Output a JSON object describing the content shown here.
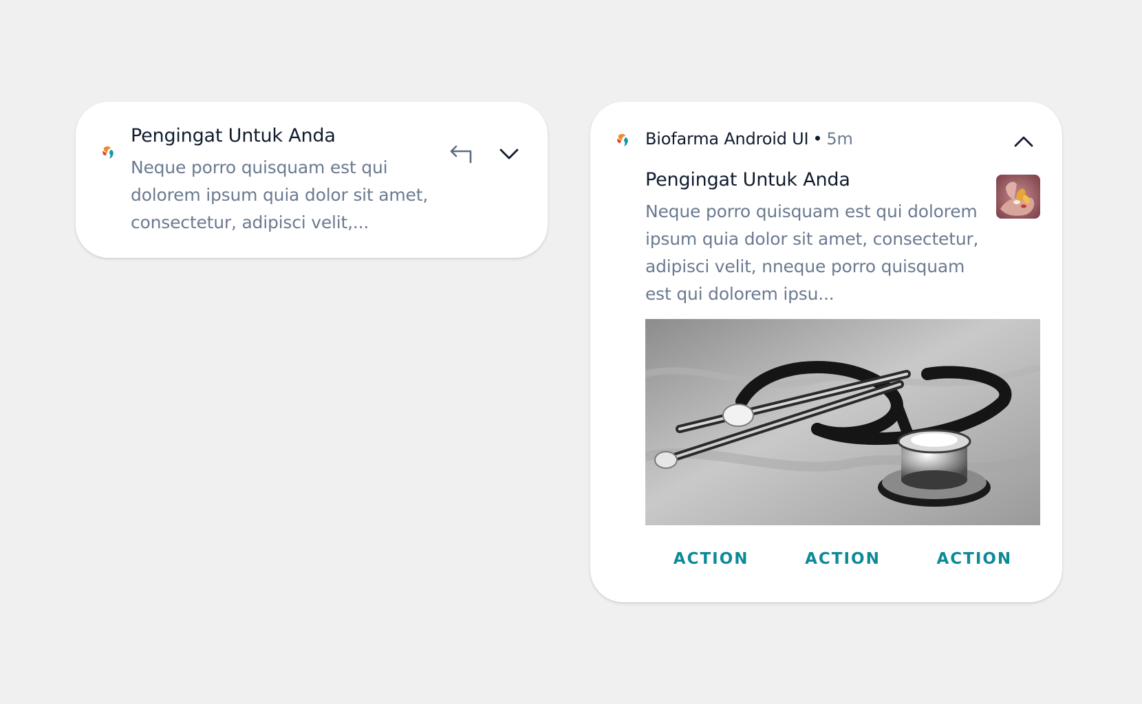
{
  "collapsed": {
    "app_icon": "biofarma-logo-icon",
    "title": "Pengingat Untuk Anda",
    "body": "Neque porro quisquam est qui dolorem ipsum quia dolor sit amet, consectetur, adipisci velit,...",
    "reply_icon": "reply-arrow-icon",
    "expand_icon": "chevron-down-icon"
  },
  "expanded": {
    "app_icon": "biofarma-logo-icon",
    "app_name": "Biofarma Android UI",
    "separator": "•",
    "time": "5m",
    "collapse_icon": "chevron-up-icon",
    "title": "Pengingat Untuk Anda",
    "body": "Neque porro quisquam est qui dolorem ipsum quia dolor sit amet, consectetur, adipisci velit, nneque porro quisquam est qui dolorem ipsu...",
    "thumbnail": "pills-in-hand-image",
    "image": "stethoscope-image",
    "actions": [
      "ACTION",
      "ACTION",
      "ACTION"
    ]
  },
  "colors": {
    "background": "#f0f0f0",
    "card": "#ffffff",
    "title_text": "#0f1b2d",
    "body_text": "#6b7a90",
    "action_text": "#0c8a98",
    "icon_orange": "#f08a24",
    "icon_red": "#e4432d",
    "icon_teal": "#1597a8"
  }
}
